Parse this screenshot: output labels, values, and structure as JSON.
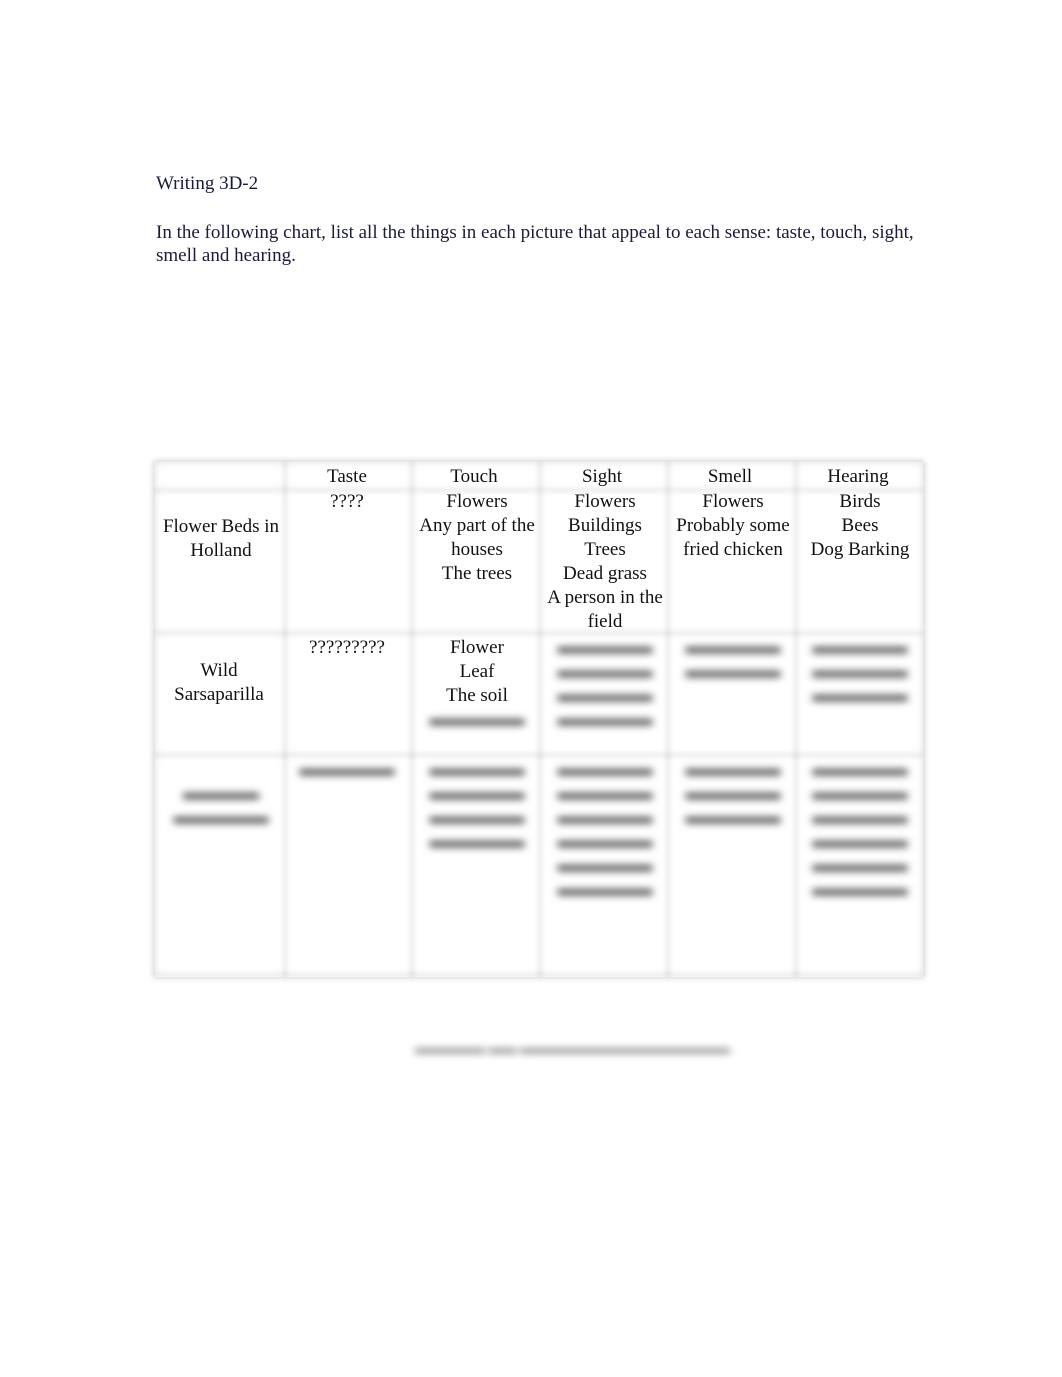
{
  "document": {
    "heading": "Writing 3D-2",
    "instructions": "In the following chart, list all the things in each picture that appeal to each sense: taste, touch, sight, smell and hearing."
  },
  "table": {
    "headers": [
      "",
      "Taste",
      "Touch",
      "Sight",
      "Smell",
      "Hearing"
    ],
    "rows": [
      {
        "label": "Flower Beds in Holland",
        "taste": [
          "????"
        ],
        "touch": [
          "Flowers",
          "Any part of the houses",
          "The trees"
        ],
        "sight": [
          "Flowers",
          "Buildings",
          "Trees",
          "Dead grass",
          "A person in the field"
        ],
        "smell": [
          "Flowers",
          "Probably some fried chicken"
        ],
        "hearing": [
          "Birds",
          "Bees",
          "Dog Barking"
        ]
      },
      {
        "label": "Wild Sarsaparilla",
        "taste": [
          "?????????"
        ],
        "touch": [
          "Flower",
          "Leaf",
          "The soil",
          "[blurred]"
        ],
        "sight": [
          "[blurred]",
          "[blurred]",
          "[blurred]",
          "[blurred]"
        ],
        "smell": [
          "[blurred]",
          "[blurred]"
        ],
        "hearing": [
          "[blurred]",
          "[blurred]",
          "[blurred]"
        ]
      },
      {
        "label": "[blurred]",
        "taste": [
          "[blurred]"
        ],
        "touch": [
          "[blurred]",
          "[blurred]",
          "[blurred]",
          "[blurred]"
        ],
        "sight": [
          "[blurred]",
          "[blurred]",
          "[blurred]",
          "[blurred]",
          "[blurred]",
          "[blurred]"
        ],
        "smell": [
          "[blurred]",
          "[blurred]",
          "[blurred]"
        ],
        "hearing": [
          "[blurred]",
          "[blurred]",
          "[blurred]",
          "[blurred]",
          "[blurred]",
          "[blurred]"
        ]
      }
    ]
  },
  "footer": "[blurred]"
}
